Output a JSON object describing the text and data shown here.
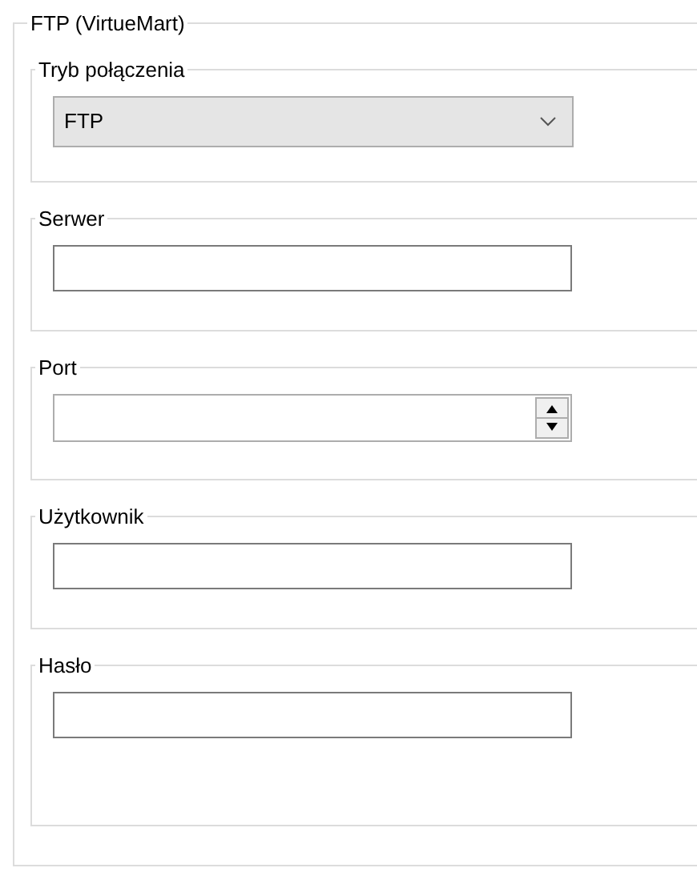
{
  "panel": {
    "title": "FTP (VirtueMart)"
  },
  "groups": [
    {
      "label": "Tryb połączenia",
      "kind": "select",
      "value": "FTP"
    },
    {
      "label": "Serwer",
      "kind": "text"
    },
    {
      "label": "Port",
      "kind": "spinner"
    },
    {
      "label": "Użytkownik",
      "kind": "text"
    },
    {
      "label": "Hasło",
      "kind": "password"
    }
  ]
}
